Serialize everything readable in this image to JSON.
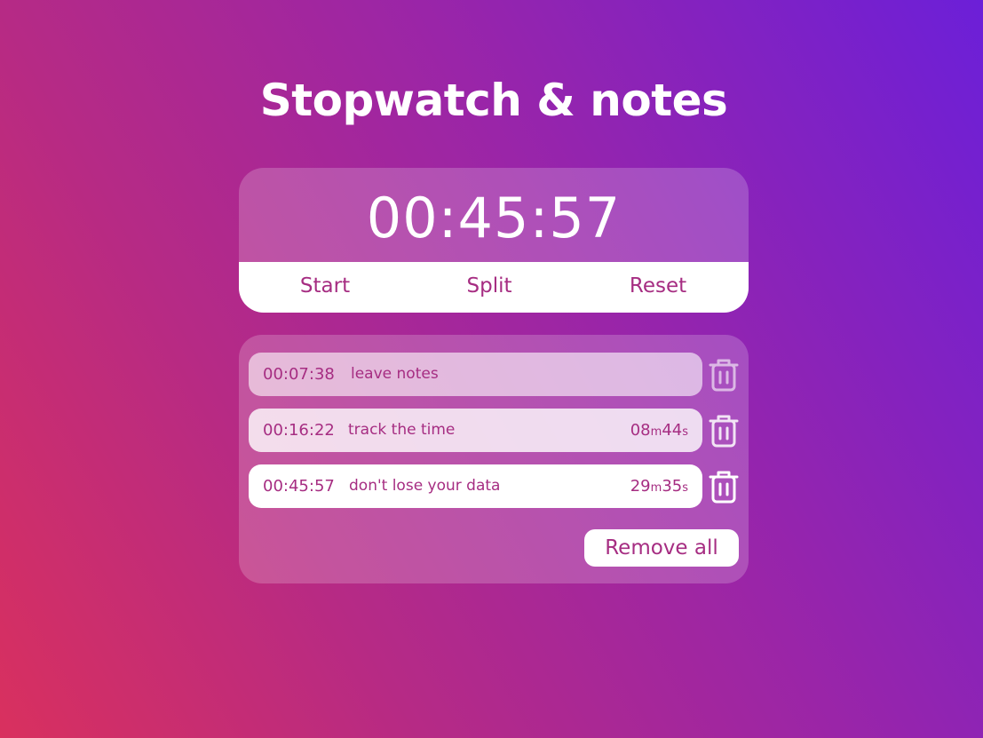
{
  "title": "Stopwatch & notes",
  "timer": {
    "display": "00:45:57",
    "controls": {
      "start": "Start",
      "split": "Split",
      "reset": "Reset"
    }
  },
  "notes": [
    {
      "time": "00:07:38",
      "text": "leave notes",
      "dur_m": "",
      "dur_m_unit": "",
      "dur_s": "",
      "dur_s_unit": ""
    },
    {
      "time": "00:16:22",
      "text": "track the time",
      "dur_m": "08",
      "dur_m_unit": "m",
      "dur_s": "44",
      "dur_s_unit": "s"
    },
    {
      "time": "00:45:57",
      "text": "don't lose your data",
      "dur_m": "29",
      "dur_m_unit": "m",
      "dur_s": "35",
      "dur_s_unit": "s"
    }
  ],
  "remove_all_label": "Remove all",
  "icons": {
    "delete": "trash-icon"
  },
  "colors": {
    "accent": "#a62d82",
    "background_start": "#d9305e",
    "background_end": "#6c1fd8"
  }
}
